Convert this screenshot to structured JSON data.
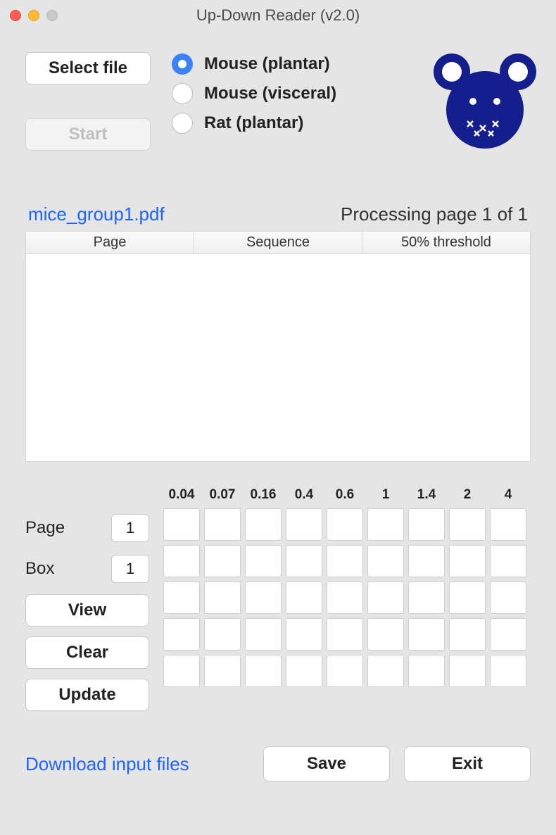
{
  "window": {
    "title": "Up-Down Reader (v2.0)"
  },
  "buttons": {
    "select_file": "Select file",
    "start": "Start",
    "view": "View",
    "clear": "Clear",
    "update": "Update",
    "save": "Save",
    "exit": "Exit"
  },
  "radios": {
    "mouse_plantar": "Mouse (plantar)",
    "mouse_visceral": "Mouse (visceral)",
    "rat_plantar": "Rat (plantar)",
    "selected": "mouse_plantar"
  },
  "file": {
    "name": "mice_group1.pdf",
    "status": "Processing page 1 of 1"
  },
  "table": {
    "columns": [
      "Page",
      "Sequence",
      "50% threshold"
    ]
  },
  "fields": {
    "page_label": "Page",
    "page_value": "1",
    "box_label": "Box",
    "box_value": "1"
  },
  "grid": {
    "headers": [
      "0.04",
      "0.07",
      "0.16",
      "0.4",
      "0.6",
      "1",
      "1.4",
      "2",
      "4"
    ],
    "rows": 5,
    "cols": 9
  },
  "link": {
    "download": "Download input files"
  }
}
